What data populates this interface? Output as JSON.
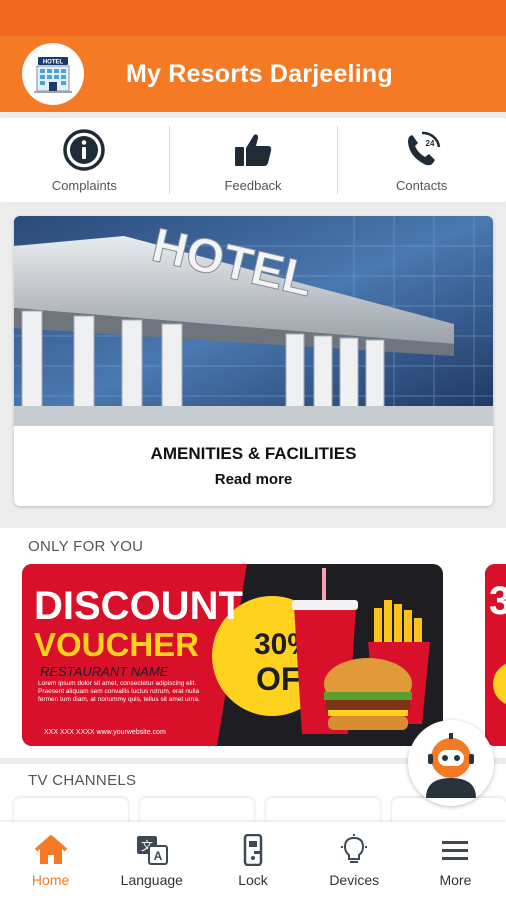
{
  "app": {
    "title": "My Resorts Darjeeling",
    "logo_text": "HOTEL"
  },
  "quick_actions": [
    {
      "label": "Complaints",
      "icon": "info-icon"
    },
    {
      "label": "Feedback",
      "icon": "thumbs-up-icon"
    },
    {
      "label": "Contacts",
      "icon": "phone-24-icon"
    }
  ],
  "feature_card": {
    "image_text": "HOTEL",
    "title": "AMENITIES & FACILITIES",
    "link": "Read more"
  },
  "offers": {
    "title": "ONLY FOR YOU",
    "voucher": {
      "headline": "DISCOUNT",
      "subheadline": "VOUCHER",
      "restaurant": "RESTAURANT NAME",
      "body": "Lorem ipsum dolor sit amet, consectetur adipiscing elit. Praesent aliquam sem convallis luctus rutrum, erat nulla fermen tum diam, at nonummy quis, tellus sit amet urna.",
      "phone": "XXX XXX XXXX www.yourwebsite.com",
      "percent": "30%",
      "off": "OFF",
      "second_digit": "3"
    }
  },
  "channels": {
    "title": "TV CHANNELS"
  },
  "nav": [
    {
      "label": "Home",
      "icon": "home-icon",
      "active": true
    },
    {
      "label": "Language",
      "icon": "language-icon"
    },
    {
      "label": "Lock",
      "icon": "door-lock-icon"
    },
    {
      "label": "Devices",
      "icon": "lightbulb-icon"
    },
    {
      "label": "More",
      "icon": "menu-icon"
    }
  ],
  "colors": {
    "primary": "#f47a26",
    "status_bar": "#f26a21",
    "voucher_red": "#d8102a",
    "voucher_yellow": "#ffd21f"
  }
}
